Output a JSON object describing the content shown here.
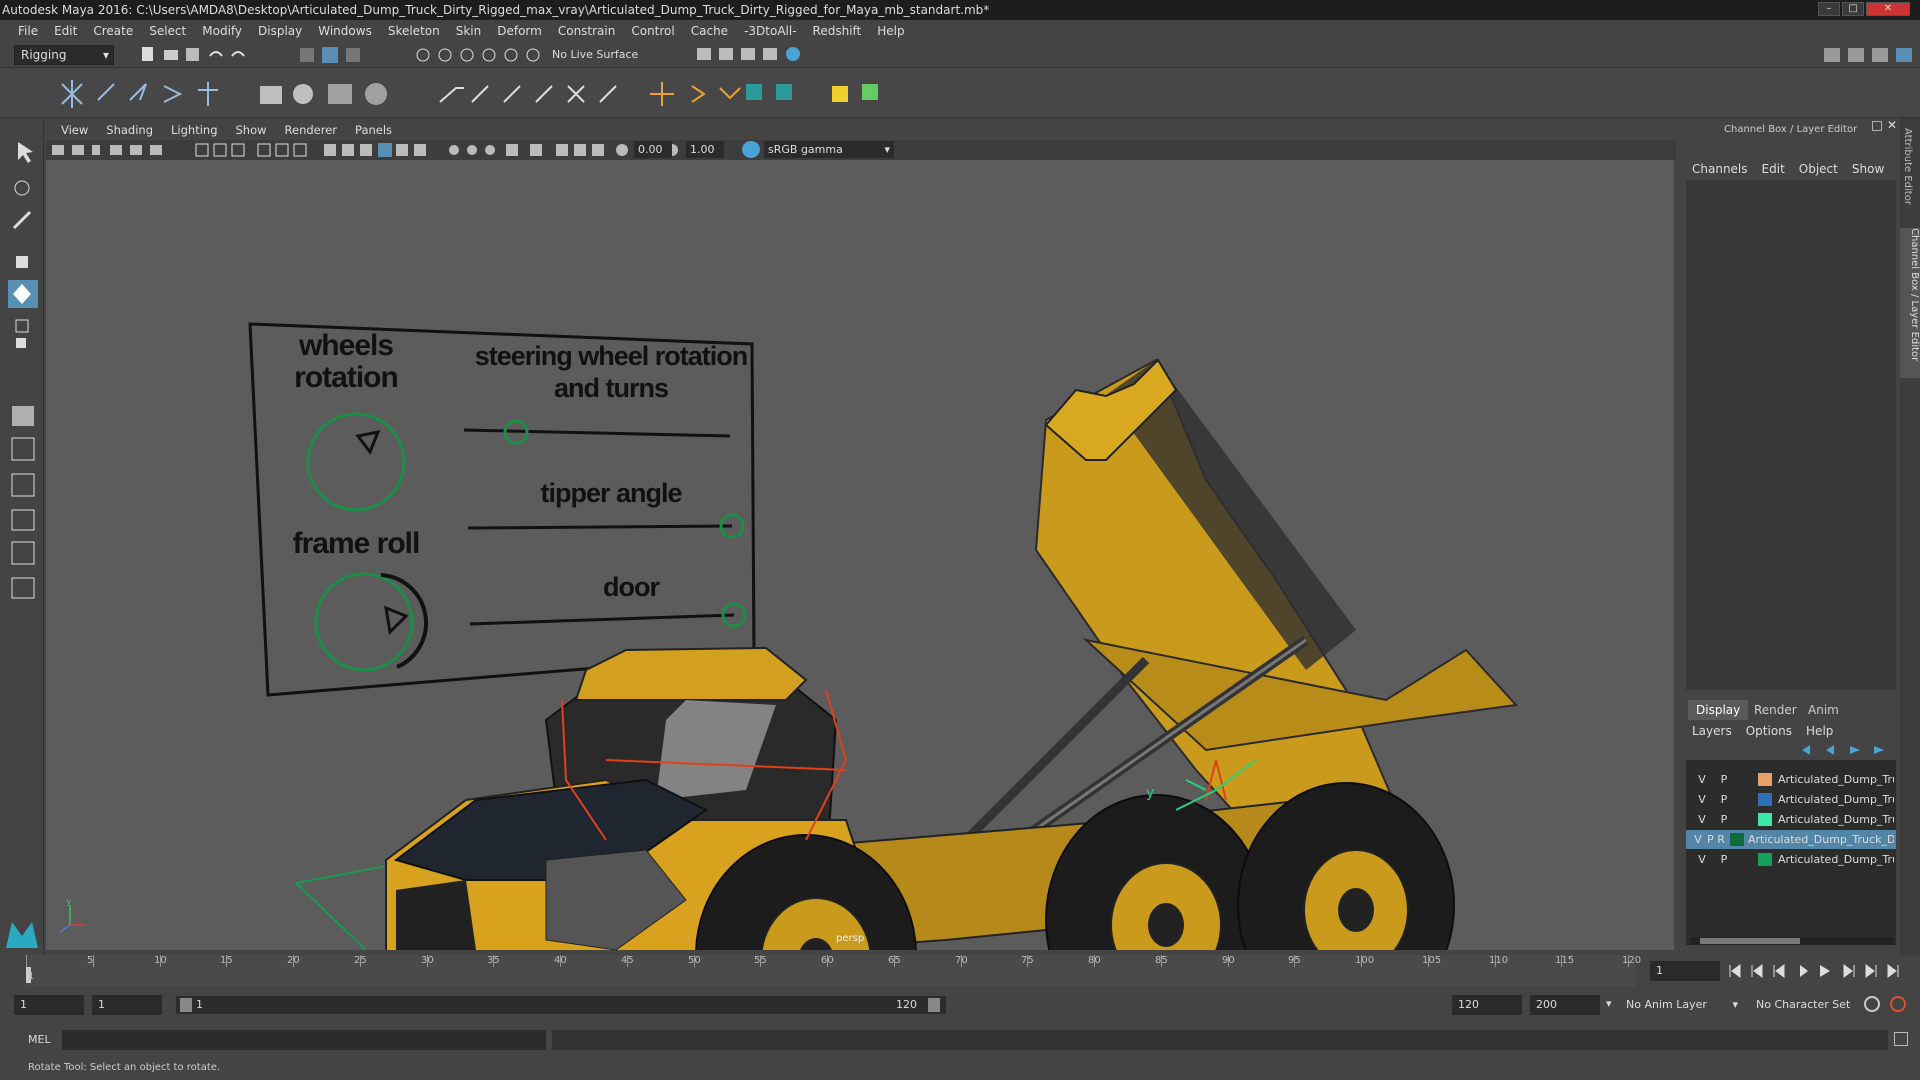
{
  "window": {
    "title": "Autodesk Maya 2016: C:\\Users\\AMDA8\\Desktop\\Articulated_Dump_Truck_Dirty_Rigged_max_vray\\Articulated_Dump_Truck_Dirty_Rigged_for_Maya_mb_standart.mb*"
  },
  "menus": [
    "File",
    "Edit",
    "Create",
    "Select",
    "Modify",
    "Display",
    "Windows",
    "Skeleton",
    "Skin",
    "Deform",
    "Constrain",
    "Control",
    "Cache",
    "-3DtoAll-",
    "Redshift",
    "Help"
  ],
  "status_line": {
    "mode": "Rigging",
    "live_surface": "No Live Surface"
  },
  "viewport": {
    "menus": [
      "View",
      "Shading",
      "Lighting",
      "Show",
      "Renderer",
      "Panels"
    ],
    "exposure": "0.00",
    "gamma": "1.00",
    "color_space": "sRGB gamma",
    "camera_label": "persp",
    "controls_board": {
      "wheels_rotation": "wheels rotation",
      "steering": "steering wheel rotation and turns",
      "frame_roll": "frame roll",
      "tipper_angle": "tipper angle",
      "door": "door"
    },
    "axis_y": "y",
    "axis_x": "x",
    "axis_z": "z"
  },
  "channel_box": {
    "title": "Channel Box / Layer Editor",
    "menus": [
      "Channels",
      "Edit",
      "Object",
      "Show"
    ]
  },
  "layer_editor": {
    "tabs": [
      "Display",
      "Render",
      "Anim"
    ],
    "active_tab": "Display",
    "menus": [
      "Layers",
      "Options",
      "Help"
    ],
    "layers": [
      {
        "v": "V",
        "p": "P",
        "color": "#e8a06a",
        "name": "Articulated_Dump_Truc"
      },
      {
        "v": "V",
        "p": "P",
        "color": "#2f6fb5",
        "name": "Articulated_Dump_Truc"
      },
      {
        "v": "V",
        "p": "P",
        "color": "#3ee6a8",
        "name": "Articulated_Dump_Truc"
      },
      {
        "v": "V",
        "p": "P R",
        "color": "#0e6b3a",
        "name": "Articulated_Dump_Truck_Dirt"
      },
      {
        "v": "V",
        "p": "P",
        "color": "#14a05a",
        "name": "Articulated_Dump_Truc"
      }
    ]
  },
  "side_tabs": [
    "Attribute Editor",
    "Channel Box / Layer Editor"
  ],
  "timeline": {
    "ticks": [
      "5",
      "10",
      "15",
      "20",
      "25",
      "30",
      "35",
      "40",
      "45",
      "50",
      "55",
      "60",
      "65",
      "70",
      "75",
      "80",
      "85",
      "90",
      "95",
      "100",
      "105",
      "110",
      "115",
      "120"
    ],
    "current_frame_marker": "1",
    "current_frame": "1"
  },
  "range": {
    "start": "1",
    "playback_start": "1",
    "slider_start": "1",
    "slider_end": "120",
    "playback_end": "120",
    "end": "200",
    "anim_layer": "No Anim Layer",
    "character_set": "No Character Set"
  },
  "command_line": {
    "label": "MEL"
  },
  "help_line": {
    "text": "Rotate Tool: Select an object to rotate."
  }
}
